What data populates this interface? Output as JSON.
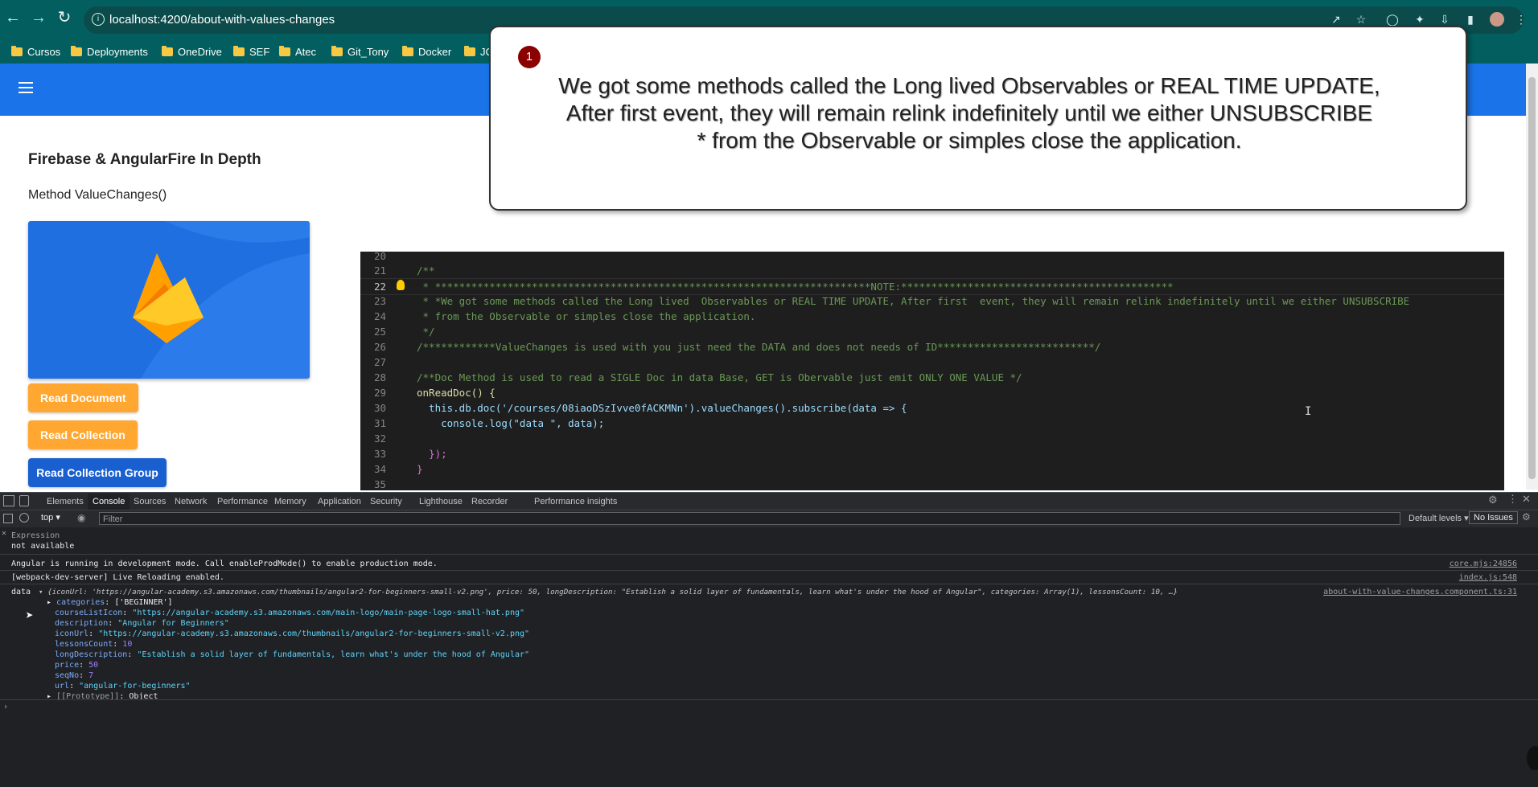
{
  "browser": {
    "url": "localhost:4200/about-with-values-changes",
    "bookmarks": [
      "Cursos",
      "Deployments",
      "OneDrive",
      "SEF",
      "Atec",
      "Git_Tony",
      "Docker",
      "JC"
    ]
  },
  "app": {
    "title": "Firebase & AngularFire In Depth",
    "subtitle": "Method ValueChanges()",
    "buttons": {
      "read_document": "Read Document",
      "read_collection": "Read Collection",
      "read_collection_group": "Read Collection Group"
    }
  },
  "callout": {
    "badge": "1",
    "line1": "We got some methods called the Long lived  Observables or REAL TIME UPDATE,",
    "line2": "After first  event, they will remain relink indefinitely until we either UNSUBSCRIBE",
    "line3": "* from the Observable or simples close the application."
  },
  "editor": {
    "lines": [
      {
        "n": "20",
        "text": ""
      },
      {
        "n": "21",
        "text": "/**"
      },
      {
        "n": "22",
        "text": " * ************************************************************************NOTE:*********************************************"
      },
      {
        "n": "23",
        "text": " * *We got some methods called the Long lived  Observables or REAL TIME UPDATE, After first  event, they will remain relink indefinitely until we either UNSUBSCRIBE"
      },
      {
        "n": "24",
        "text": " * from the Observable or simples close the application."
      },
      {
        "n": "25",
        "text": " */"
      },
      {
        "n": "26",
        "text": "/************ValueChanges is used with you just need the DATA and does not needs of ID**************************/"
      },
      {
        "n": "27",
        "text": ""
      },
      {
        "n": "28",
        "text": "/**Doc Method is used to read a SIGLE Doc in data Base, GET is Obervable just emit ONLY ONE VALUE */"
      },
      {
        "n": "29",
        "text": "onReadDoc() {"
      },
      {
        "n": "30",
        "text": "  this.db.doc('/courses/08iaoDSzIvve0fACKMNn').valueChanges().subscribe(data => {"
      },
      {
        "n": "31",
        "text": "    console.log(\"data \", data);"
      },
      {
        "n": "32",
        "text": ""
      },
      {
        "n": "33",
        "text": "  });"
      },
      {
        "n": "34",
        "text": "}"
      },
      {
        "n": "35",
        "text": ""
      }
    ]
  },
  "devtools": {
    "tabs": [
      "Elements",
      "Console",
      "Sources",
      "Network",
      "Performance",
      "Memory",
      "Application",
      "Security",
      "Lighthouse",
      "Recorder",
      "Performance insights"
    ],
    "active_tab": "Console",
    "context": "top",
    "filter_placeholder": "Filter",
    "levels": "Default levels",
    "issues": "No Issues",
    "expression_label": "Expression",
    "expression_value": "not available",
    "messages": [
      {
        "text": "Angular is running in development mode. Call enableProdMode() to enable production mode.",
        "source": "core.mjs:24856"
      },
      {
        "text": "[webpack-dev-server] Live Reloading enabled.",
        "source": "index.js:548"
      }
    ],
    "data_log": {
      "label": "data",
      "summary": "{iconUrl: 'https://angular-academy.s3.amazonaws.com/thumbnails/angular2-for-beginners-small-v2.png', price: 50, longDescription: \"Establish a solid layer of fundamentals, learn what's under the hood of Angular\", categories: Array(1), lessonsCount: 10, …}",
      "source": "about-with-value-changes.component.ts:31",
      "props": [
        {
          "key": "categories",
          "value": "['BEGINNER']"
        },
        {
          "key": "courseListIcon",
          "value": "\"https://angular-academy.s3.amazonaws.com/main-logo/main-page-logo-small-hat.png\""
        },
        {
          "key": "description",
          "value": "\"Angular for Beginners\""
        },
        {
          "key": "iconUrl",
          "value": "\"https://angular-academy.s3.amazonaws.com/thumbnails/angular2-for-beginners-small-v2.png\""
        },
        {
          "key": "lessonsCount",
          "value": "10"
        },
        {
          "key": "longDescription",
          "value": "\"Establish a solid layer of fundamentals, learn what's under the hood of Angular\""
        },
        {
          "key": "price",
          "value": "50"
        },
        {
          "key": "seqNo",
          "value": "7"
        },
        {
          "key": "url",
          "value": "\"angular-for-beginners\""
        },
        {
          "key": "[[Prototype]]",
          "value": "Object"
        }
      ]
    }
  }
}
